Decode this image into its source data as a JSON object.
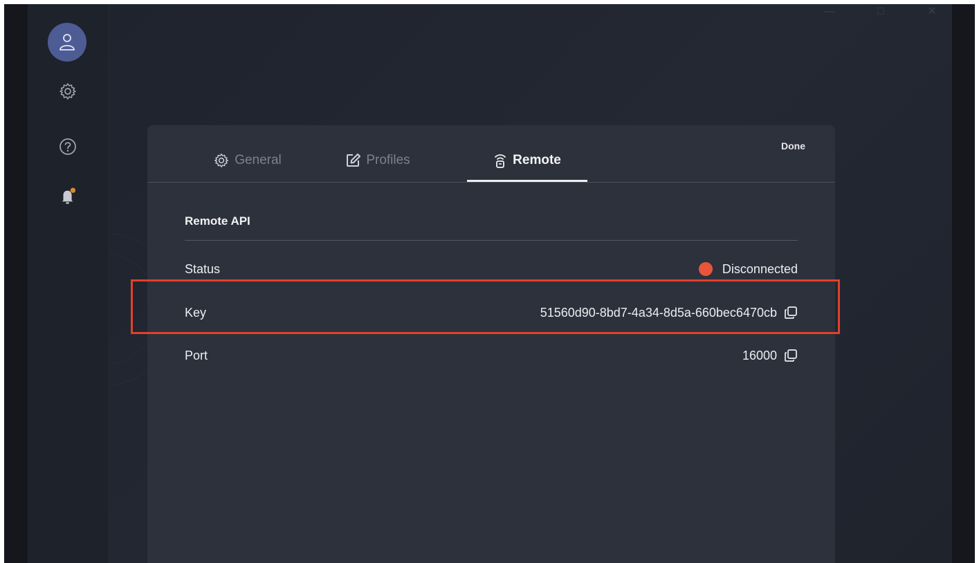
{
  "window": {
    "controls": [
      "minimize",
      "maximize",
      "close"
    ]
  },
  "sidebar": {
    "icons": [
      "user-icon",
      "gear-icon",
      "help-icon",
      "bell-icon"
    ],
    "notification_color": "#d98a2b",
    "avatar_color": "#4e5c95"
  },
  "dialog": {
    "done_label": "Done",
    "tabs": [
      {
        "label": "General",
        "icon": "gear-icon",
        "active": false
      },
      {
        "label": "Profiles",
        "icon": "edit-icon",
        "active": false
      },
      {
        "label": "Remote",
        "icon": "remote-icon",
        "active": true
      }
    ],
    "section_title": "Remote API",
    "rows": {
      "status": {
        "label": "Status",
        "value": "Disconnected",
        "status_color": "#e8553a"
      },
      "key": {
        "label": "Key",
        "value": "51560d90-8bd7-4a34-8d5a-660bec6470cb",
        "icon": "copy-icon"
      },
      "port": {
        "label": "Port",
        "value": "16000",
        "icon": "copy-icon"
      }
    }
  },
  "highlight_color": "#e2402b"
}
